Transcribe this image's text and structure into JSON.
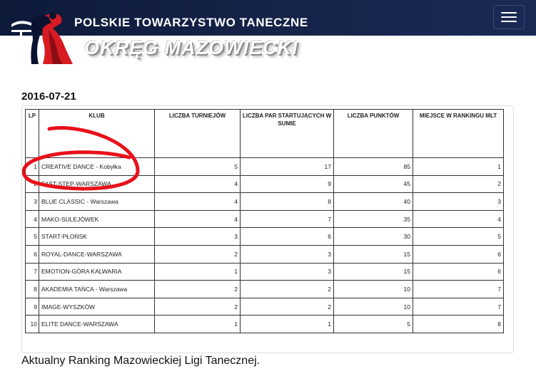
{
  "header": {
    "org_name": "POLSKIE TOWARZYSTWO TANECZNE",
    "region_name": "OKRĘG MAZOWIECKI",
    "menu_toggle": "menu"
  },
  "post": {
    "date": "2016-07-21",
    "caption": "Aktualny Ranking Mazowieckiej Ligi Tanecznej."
  },
  "ranking": {
    "columns": [
      "LP",
      "KLUB",
      "LICZBA TURNIEJÓW",
      "LICZBA PAR STARTUJĄCYCH W SUMIE",
      "LICZBA PUNKTÓW",
      "MIEJSCE W RANKINGU MLT"
    ],
    "rows": [
      {
        "lp": "1",
        "club": "CREATIVE DANCE - Kobyłka",
        "tournaments": "5",
        "pairs": "17",
        "points": "85",
        "place": "1"
      },
      {
        "lp": "2",
        "club": "FAST-STEP-WARSZAWA",
        "tournaments": "4",
        "pairs": "9",
        "points": "45",
        "place": "2"
      },
      {
        "lp": "3",
        "club": "BLUE CLASSIC - Warszawa",
        "tournaments": "4",
        "pairs": "8",
        "points": "40",
        "place": "3"
      },
      {
        "lp": "4",
        "club": "MAKO-SULEJÓWEK",
        "tournaments": "4",
        "pairs": "7",
        "points": "35",
        "place": "4"
      },
      {
        "lp": "5",
        "club": "START-PŁOŃSK",
        "tournaments": "3",
        "pairs": "6",
        "points": "30",
        "place": "5"
      },
      {
        "lp": "6",
        "club": "ROYAL-DANCE-WARSZAWA",
        "tournaments": "2",
        "pairs": "3",
        "points": "15",
        "place": "6"
      },
      {
        "lp": "7",
        "club": "EMOTION-GÓRA KALWARIA",
        "tournaments": "1",
        "pairs": "3",
        "points": "15",
        "place": "6"
      },
      {
        "lp": "8",
        "club": "AKADEMIA TAŃCA - Warszawa",
        "tournaments": "2",
        "pairs": "2",
        "points": "10",
        "place": "7"
      },
      {
        "lp": "9",
        "club": "IMAGE-WYSZKÓW",
        "tournaments": "2",
        "pairs": "2",
        "points": "10",
        "place": "7"
      },
      {
        "lp": "10",
        "club": "ELITE DANCE-WARSZAWA",
        "tournaments": "1",
        "pairs": "1",
        "points": "5",
        "place": "8"
      }
    ]
  },
  "colors": {
    "navbar": "#0d1a3a",
    "annotation": "#e8101a"
  }
}
